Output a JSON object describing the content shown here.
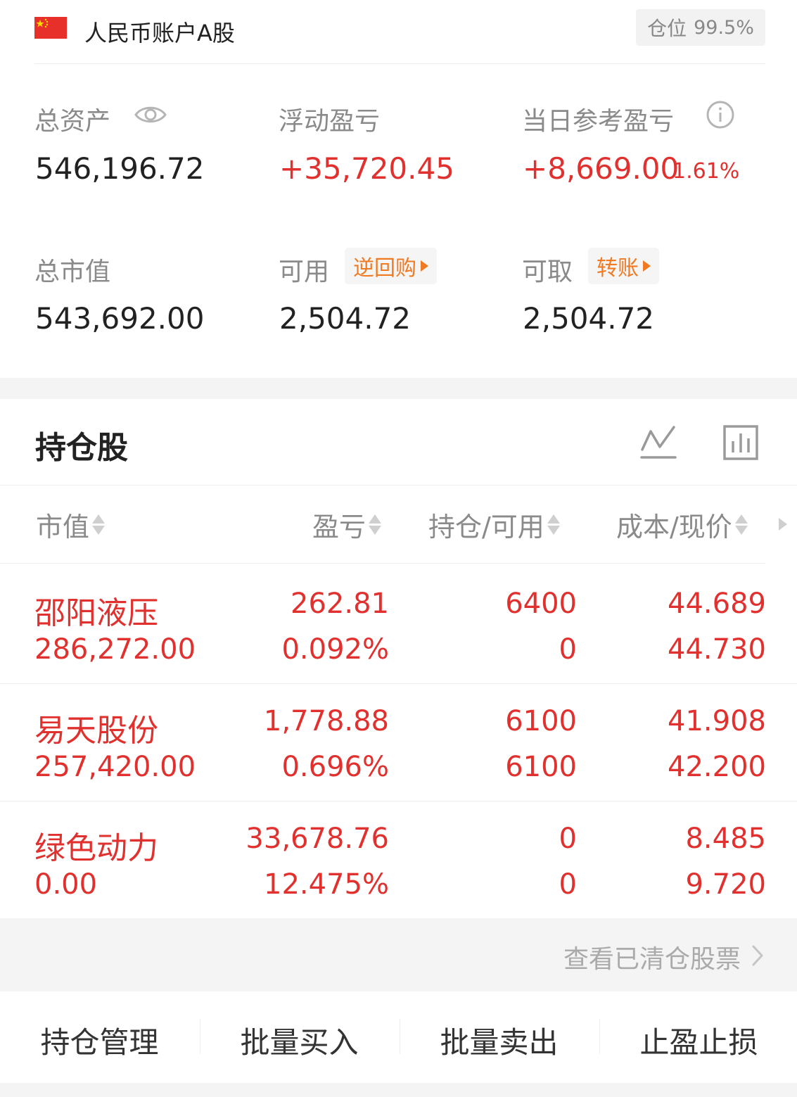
{
  "account": {
    "name": "人民币账户A股",
    "position_label": "仓位",
    "position_value": "99.5%"
  },
  "summary": {
    "total_assets_label": "总资产",
    "total_assets_value": "546,196.72",
    "floating_pl_label": "浮动盈亏",
    "floating_pl_value": "+35,720.45",
    "daily_pl_label": "当日参考盈亏",
    "daily_pl_value": "+8,669.00",
    "daily_pl_pct": "1.61%",
    "market_value_label": "总市值",
    "market_value_value": "543,692.00",
    "available_label": "可用",
    "available_tag": "逆回购",
    "available_value": "2,504.72",
    "withdrawable_label": "可取",
    "withdrawable_tag": "转账",
    "withdrawable_value": "2,504.72"
  },
  "holdings": {
    "title": "持仓股",
    "columns": [
      "市值",
      "盈亏",
      "持仓/可用",
      "成本/现价"
    ],
    "rows": [
      {
        "name": "邵阳液压",
        "market_value": "286,272.00",
        "pl": "262.81",
        "pl_pct": "0.092%",
        "position": "6400",
        "available": "0",
        "cost": "44.689",
        "price": "44.730"
      },
      {
        "name": "易天股份",
        "market_value": "257,420.00",
        "pl": "1,778.88",
        "pl_pct": "0.696%",
        "position": "6100",
        "available": "6100",
        "cost": "41.908",
        "price": "42.200"
      },
      {
        "name": "绿色动力",
        "market_value": "0.00",
        "pl": "33,678.76",
        "pl_pct": "12.475%",
        "position": "0",
        "available": "0",
        "cost": "8.485",
        "price": "9.720"
      }
    ],
    "cleared_link": "查看已清仓股票"
  },
  "actions": [
    "持仓管理",
    "批量买入",
    "批量卖出",
    "止盈止损"
  ],
  "colors": {
    "up_red": "#e0312f",
    "tag_orange": "#f07a22",
    "flag_red": "#e8302a"
  }
}
